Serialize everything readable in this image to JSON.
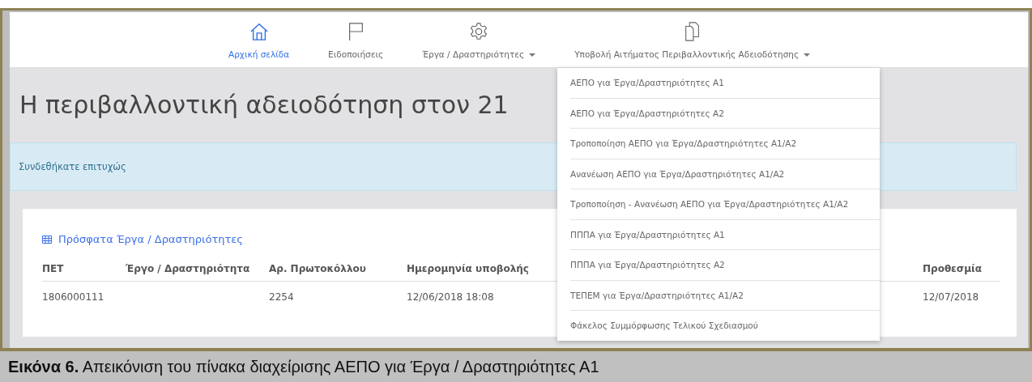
{
  "nav": [
    {
      "label": "Αρχική σελίδα",
      "selected": true,
      "caret": false
    },
    {
      "label": "Ειδοποιήσεις",
      "selected": false,
      "caret": false
    },
    {
      "label": "Έργα / Δραστηριότητες",
      "selected": false,
      "caret": true
    },
    {
      "label": "Υποβολή Αιτήματος Περιβαλλοντικής Αδειοδότησης",
      "selected": false,
      "caret": true
    }
  ],
  "dropdown": [
    "ΑΕΠΟ για Έργα/Δραστηριότητες Α1",
    "ΑΕΠΟ για Έργα/Δραστηριότητες Α2",
    "Τροποποίηση ΑΕΠΟ για Έργα/Δραστηριότητες Α1/Α2",
    "Ανανέωση ΑΕΠΟ για Έργα/Δραστηριότητες Α1/Α2",
    "Τροποποίηση - Ανανέωση ΑΕΠΟ για Έργα/Δραστηριότητες Α1/Α2",
    "ΠΠΠΑ για Έργα/Δραστηριότητες Α1",
    "ΠΠΠΑ για Έργα/Δραστηριότητες Α2",
    "ΤΕΠΕΜ για Έργα/Δραστηριότητες Α1/Α2",
    "Φάκελος Συμμόρφωσης Τελικού Σχεδιασμού"
  ],
  "heading": "Η περιβαλλοντική αδειοδότηση στον 21",
  "alert": "Συνδεθήκατε επιτυχώς",
  "panel": {
    "title": "Πρόσφατα Έργα / Δραστηριότητες",
    "columns": {
      "pet": "ΠΕΤ",
      "project": "Έργο / Δραστηριότητα",
      "protocol": "Αρ. Πρωτοκόλλου",
      "submitted": "Ημερομηνία υποβολής",
      "deadline": "Προθεσμία"
    },
    "rows": [
      {
        "pet": "1806000111",
        "protocol": "2254",
        "submitted": "12/06/2018 18:08",
        "deadline": "12/07/2018"
      }
    ]
  },
  "caption": "**Εικόνα 6.** Απεικόνιση του πίνακα διαχείρισης ΑΕΠΟ για Έργα / Δραστηριότητες Α1"
}
